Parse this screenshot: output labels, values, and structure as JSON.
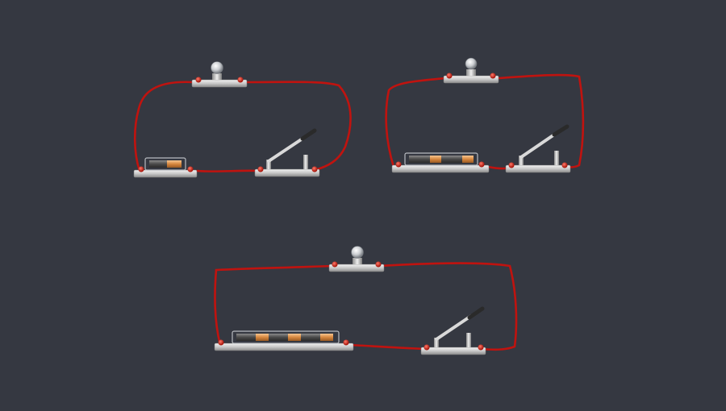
{
  "background": "#353841",
  "wire_color": "#c0130f",
  "terminal_color": "#d42418",
  "circuits": [
    {
      "name": "circuit-one-cell",
      "cells": 1,
      "components": [
        "battery-icon",
        "bulb-icon",
        "knife-switch-icon"
      ],
      "switch_state": "open",
      "bulb_lit": false
    },
    {
      "name": "circuit-two-cells",
      "cells": 2,
      "components": [
        "battery-icon",
        "bulb-icon",
        "knife-switch-icon"
      ],
      "switch_state": "open",
      "bulb_lit": false
    },
    {
      "name": "circuit-three-cells",
      "cells": 3,
      "components": [
        "battery-icon",
        "bulb-icon",
        "knife-switch-icon"
      ],
      "switch_state": "open",
      "bulb_lit": false
    }
  ]
}
